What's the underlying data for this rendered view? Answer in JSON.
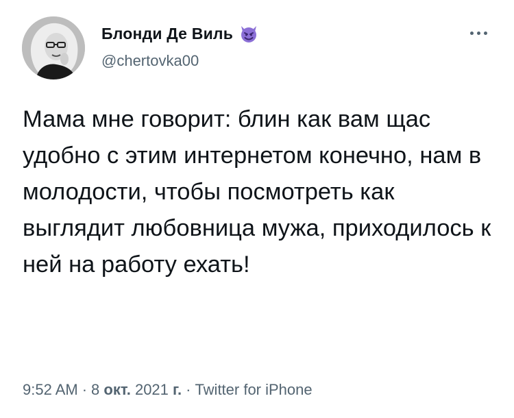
{
  "author": {
    "display_name": "Блонди Де Виль",
    "handle": "@chertovka00",
    "badge_icon": "smiling-devil-emoji-icon",
    "badge_color": "#8b6fd6"
  },
  "tweet": {
    "text": "Мама мне говорит: блин как вам щас удобно с этим интернетом конечно, нам в молодости, чтобы посмотреть как выглядит любовница мужа, приходилось к ней на работу ехать!"
  },
  "meta": {
    "time": "9:52 AM",
    "separator": "·",
    "date_day": "8",
    "date_month": "окт.",
    "date_year": "2021",
    "date_suffix": "г.",
    "source": "Twitter for iPhone"
  },
  "colors": {
    "text_primary": "#0f1419",
    "text_secondary": "#536471",
    "background": "#ffffff"
  },
  "icons": {
    "more": "more-options-icon"
  }
}
